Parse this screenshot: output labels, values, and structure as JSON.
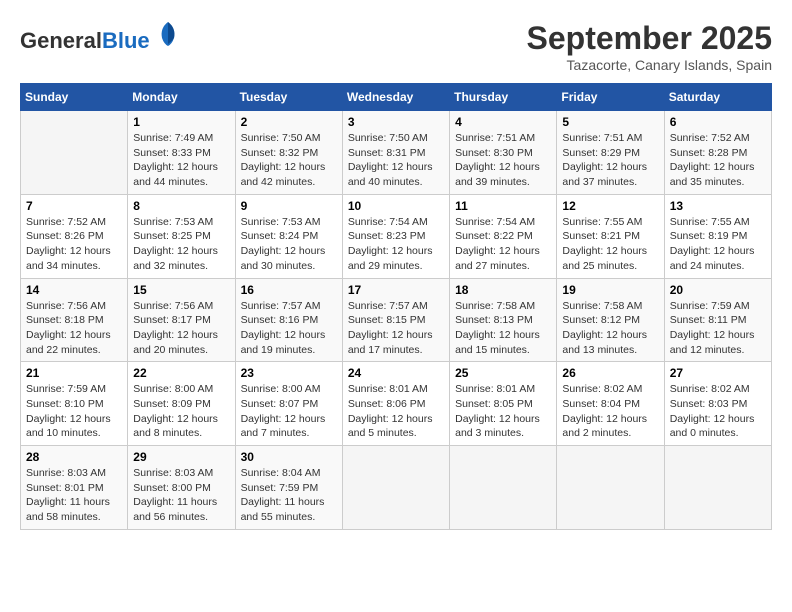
{
  "header": {
    "logo_general": "General",
    "logo_blue": "Blue",
    "month": "September 2025",
    "location": "Tazacorte, Canary Islands, Spain"
  },
  "weekdays": [
    "Sunday",
    "Monday",
    "Tuesday",
    "Wednesday",
    "Thursday",
    "Friday",
    "Saturday"
  ],
  "weeks": [
    [
      {
        "day": "",
        "info": ""
      },
      {
        "day": "1",
        "info": "Sunrise: 7:49 AM\nSunset: 8:33 PM\nDaylight: 12 hours\nand 44 minutes."
      },
      {
        "day": "2",
        "info": "Sunrise: 7:50 AM\nSunset: 8:32 PM\nDaylight: 12 hours\nand 42 minutes."
      },
      {
        "day": "3",
        "info": "Sunrise: 7:50 AM\nSunset: 8:31 PM\nDaylight: 12 hours\nand 40 minutes."
      },
      {
        "day": "4",
        "info": "Sunrise: 7:51 AM\nSunset: 8:30 PM\nDaylight: 12 hours\nand 39 minutes."
      },
      {
        "day": "5",
        "info": "Sunrise: 7:51 AM\nSunset: 8:29 PM\nDaylight: 12 hours\nand 37 minutes."
      },
      {
        "day": "6",
        "info": "Sunrise: 7:52 AM\nSunset: 8:28 PM\nDaylight: 12 hours\nand 35 minutes."
      }
    ],
    [
      {
        "day": "7",
        "info": "Sunrise: 7:52 AM\nSunset: 8:26 PM\nDaylight: 12 hours\nand 34 minutes."
      },
      {
        "day": "8",
        "info": "Sunrise: 7:53 AM\nSunset: 8:25 PM\nDaylight: 12 hours\nand 32 minutes."
      },
      {
        "day": "9",
        "info": "Sunrise: 7:53 AM\nSunset: 8:24 PM\nDaylight: 12 hours\nand 30 minutes."
      },
      {
        "day": "10",
        "info": "Sunrise: 7:54 AM\nSunset: 8:23 PM\nDaylight: 12 hours\nand 29 minutes."
      },
      {
        "day": "11",
        "info": "Sunrise: 7:54 AM\nSunset: 8:22 PM\nDaylight: 12 hours\nand 27 minutes."
      },
      {
        "day": "12",
        "info": "Sunrise: 7:55 AM\nSunset: 8:21 PM\nDaylight: 12 hours\nand 25 minutes."
      },
      {
        "day": "13",
        "info": "Sunrise: 7:55 AM\nSunset: 8:19 PM\nDaylight: 12 hours\nand 24 minutes."
      }
    ],
    [
      {
        "day": "14",
        "info": "Sunrise: 7:56 AM\nSunset: 8:18 PM\nDaylight: 12 hours\nand 22 minutes."
      },
      {
        "day": "15",
        "info": "Sunrise: 7:56 AM\nSunset: 8:17 PM\nDaylight: 12 hours\nand 20 minutes."
      },
      {
        "day": "16",
        "info": "Sunrise: 7:57 AM\nSunset: 8:16 PM\nDaylight: 12 hours\nand 19 minutes."
      },
      {
        "day": "17",
        "info": "Sunrise: 7:57 AM\nSunset: 8:15 PM\nDaylight: 12 hours\nand 17 minutes."
      },
      {
        "day": "18",
        "info": "Sunrise: 7:58 AM\nSunset: 8:13 PM\nDaylight: 12 hours\nand 15 minutes."
      },
      {
        "day": "19",
        "info": "Sunrise: 7:58 AM\nSunset: 8:12 PM\nDaylight: 12 hours\nand 13 minutes."
      },
      {
        "day": "20",
        "info": "Sunrise: 7:59 AM\nSunset: 8:11 PM\nDaylight: 12 hours\nand 12 minutes."
      }
    ],
    [
      {
        "day": "21",
        "info": "Sunrise: 7:59 AM\nSunset: 8:10 PM\nDaylight: 12 hours\nand 10 minutes."
      },
      {
        "day": "22",
        "info": "Sunrise: 8:00 AM\nSunset: 8:09 PM\nDaylight: 12 hours\nand 8 minutes."
      },
      {
        "day": "23",
        "info": "Sunrise: 8:00 AM\nSunset: 8:07 PM\nDaylight: 12 hours\nand 7 minutes."
      },
      {
        "day": "24",
        "info": "Sunrise: 8:01 AM\nSunset: 8:06 PM\nDaylight: 12 hours\nand 5 minutes."
      },
      {
        "day": "25",
        "info": "Sunrise: 8:01 AM\nSunset: 8:05 PM\nDaylight: 12 hours\nand 3 minutes."
      },
      {
        "day": "26",
        "info": "Sunrise: 8:02 AM\nSunset: 8:04 PM\nDaylight: 12 hours\nand 2 minutes."
      },
      {
        "day": "27",
        "info": "Sunrise: 8:02 AM\nSunset: 8:03 PM\nDaylight: 12 hours\nand 0 minutes."
      }
    ],
    [
      {
        "day": "28",
        "info": "Sunrise: 8:03 AM\nSunset: 8:01 PM\nDaylight: 11 hours\nand 58 minutes."
      },
      {
        "day": "29",
        "info": "Sunrise: 8:03 AM\nSunset: 8:00 PM\nDaylight: 11 hours\nand 56 minutes."
      },
      {
        "day": "30",
        "info": "Sunrise: 8:04 AM\nSunset: 7:59 PM\nDaylight: 11 hours\nand 55 minutes."
      },
      {
        "day": "",
        "info": ""
      },
      {
        "day": "",
        "info": ""
      },
      {
        "day": "",
        "info": ""
      },
      {
        "day": "",
        "info": ""
      }
    ]
  ]
}
